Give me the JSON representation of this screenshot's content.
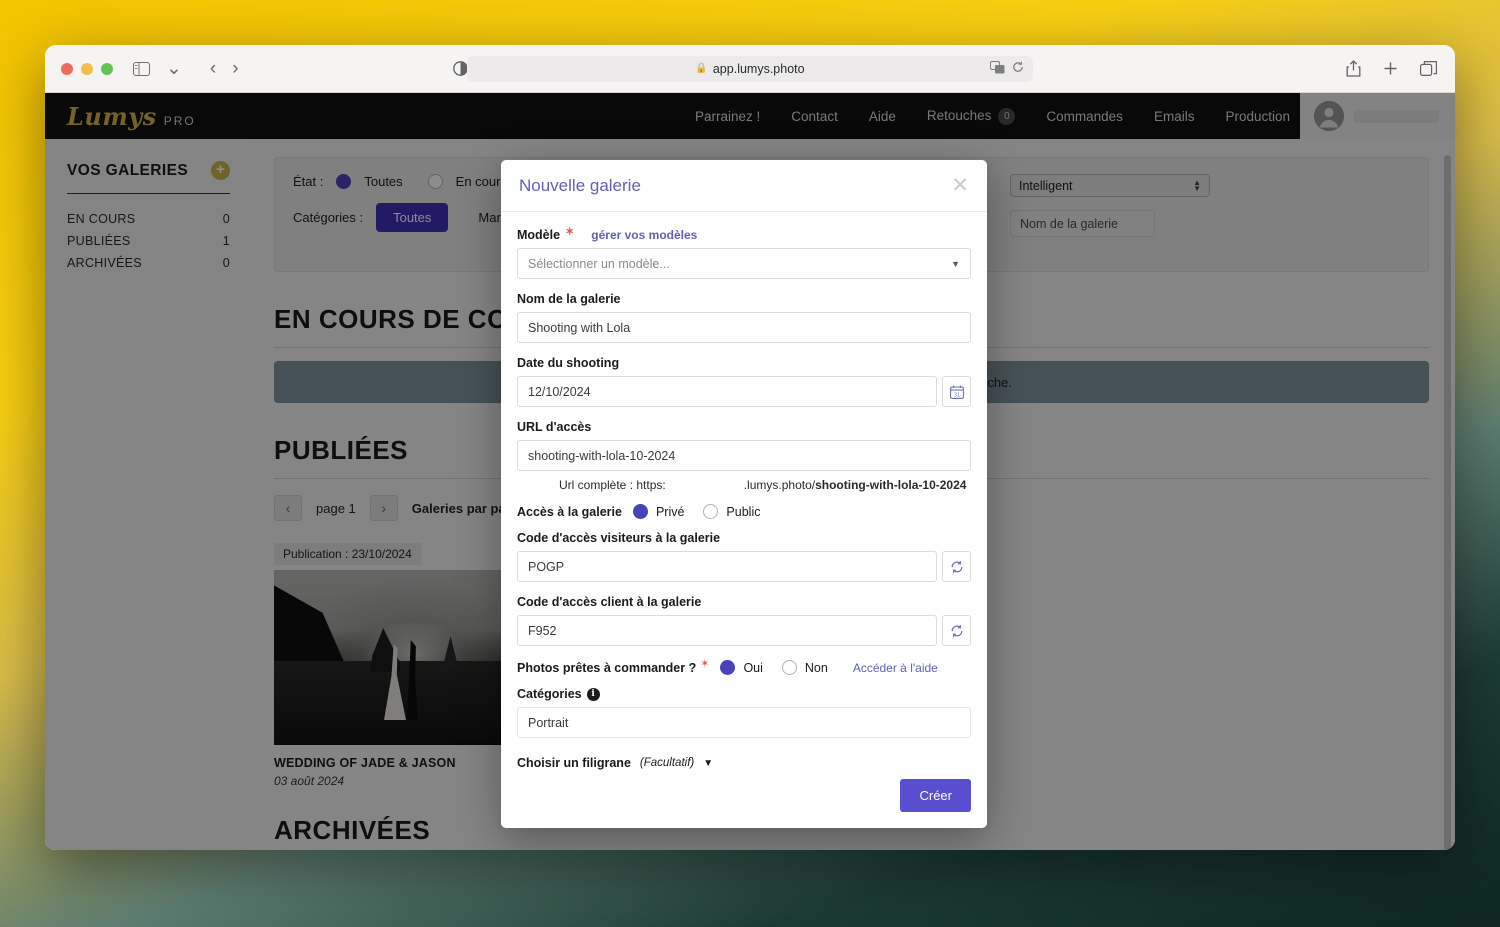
{
  "browser": {
    "url": "app.lumys.photo",
    "lock_icon": "lock-icon",
    "sidebar_toggle_icon": "sidebar-toggle-icon",
    "back_icon": "back-chevron-icon",
    "forward_icon": "forward-chevron-icon",
    "reader_icon": "reader-view-icon",
    "extension_icon": "notion-extension-icon",
    "translate_icon": "translate-icon",
    "reload_icon": "reload-icon",
    "share_icon": "share-icon",
    "new_tab_icon": "plus-icon",
    "tabs_icon": "tab-overview-icon"
  },
  "topnav": {
    "brand": "Lumys",
    "brand_suffix": "PRO",
    "links": [
      {
        "label": "Parrainez !",
        "badge": null
      },
      {
        "label": "Contact",
        "badge": null
      },
      {
        "label": "Aide",
        "badge": null
      },
      {
        "label": "Retouches",
        "badge": "0"
      },
      {
        "label": "Commandes",
        "badge": null
      },
      {
        "label": "Emails",
        "badge": null
      },
      {
        "label": "Production",
        "badge": null
      }
    ]
  },
  "sidebar": {
    "title": "VOS GALERIES",
    "add_label": "+",
    "items": [
      {
        "label": "EN COURS",
        "count": "0"
      },
      {
        "label": "PUBLIÉES",
        "count": "1"
      },
      {
        "label": "ARCHIVÉES",
        "count": "0"
      }
    ]
  },
  "filters": {
    "etat_label": "État :",
    "etat_options": [
      {
        "label": "Toutes",
        "selected": true
      },
      {
        "label": "En cours",
        "selected": false
      }
    ],
    "categories_label": "Catégories :",
    "category_chips": [
      {
        "label": "Toutes",
        "active": true
      },
      {
        "label": "Mariage",
        "active": false
      }
    ],
    "sort_value": "Intelligent",
    "search_placeholder": "Nom de la galerie"
  },
  "sections": {
    "en_cours_title": "EN COURS DE CO",
    "empty_banner": "rche.",
    "publiees_title": "PUBLIÉES",
    "archivees_title": "ARCHIVÉES"
  },
  "pager": {
    "prev_icon": "chevron-left-icon",
    "next_icon": "chevron-right-icon",
    "page_label": "page 1",
    "per_page_label": "Galeries par page :"
  },
  "gallery_card": {
    "publication": "Publication : 23/10/2024",
    "title": "WEDDING OF JADE & JASON",
    "date": "03 août 2024"
  },
  "modal": {
    "title": "Nouvelle galerie",
    "close_icon": "close-icon",
    "model": {
      "label": "Modèle",
      "required_marker": "✶",
      "manage_link": "gérer vos modèles",
      "placeholder": "Sélectionner un modèle...",
      "caret_icon": "chevron-down-icon"
    },
    "name": {
      "label": "Nom de la galerie",
      "value": "Shooting with Lola"
    },
    "shoot_date": {
      "label": "Date du shooting",
      "value": "12/10/2024",
      "icon": "calendar-icon"
    },
    "url": {
      "label": "URL d'accès",
      "value": "shooting-with-lola-10-2024",
      "full_prefix": "Url complète : https:",
      "full_domain": ".lumys.photo/",
      "full_slug": "shooting-with-lola-10-2024"
    },
    "access": {
      "label": "Accès à la galerie",
      "options": [
        {
          "label": "Privé",
          "selected": true
        },
        {
          "label": "Public",
          "selected": false
        }
      ]
    },
    "visitor_code": {
      "label": "Code d'accès visiteurs à la galerie",
      "value": "POGP",
      "refresh_icon": "refresh-icon"
    },
    "client_code": {
      "label": "Code d'accès client à la galerie",
      "value": "F952",
      "refresh_icon": "refresh-icon"
    },
    "ready_to_order": {
      "label": "Photos prêtes à commander ?",
      "required_marker": "✶",
      "options": [
        {
          "label": "Oui",
          "selected": true
        },
        {
          "label": "Non",
          "selected": false
        }
      ],
      "help_link": "Accéder à l'aide"
    },
    "categories": {
      "label": "Catégories",
      "info_icon": "info-icon",
      "value": "Portrait"
    },
    "watermark": {
      "label": "Choisir un filigrane",
      "optional": "(Facultatif)",
      "caret_icon": "triangle-down-icon"
    },
    "submit_label": "Créer"
  },
  "colors": {
    "accent": "#5b4fd1",
    "brand_gold": "#d4b544",
    "modal_title": "#5f5fbe",
    "chip_active": "#3f32b5"
  }
}
